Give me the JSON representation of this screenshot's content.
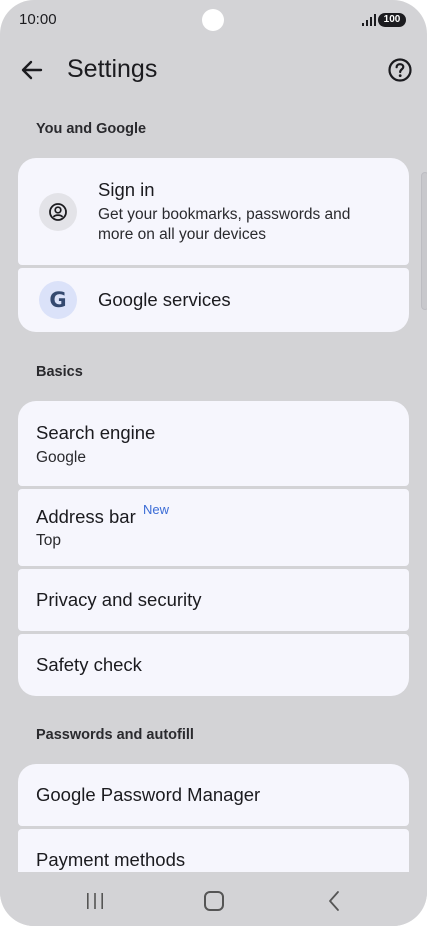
{
  "status": {
    "time": "10:00",
    "battery": "100"
  },
  "app_bar": {
    "title": "Settings"
  },
  "sections": {
    "you_and_google": {
      "header": "You and Google",
      "sign_in": {
        "title": "Sign in",
        "subtitle_line1": "Get your bookmarks, passwords and",
        "subtitle_line2": "more on all your devices"
      },
      "google_services": {
        "title": "Google services",
        "icon_letter": "G"
      }
    },
    "basics": {
      "header": "Basics",
      "search_engine": {
        "title": "Search engine",
        "value": "Google"
      },
      "address_bar": {
        "title": "Address bar",
        "badge": "New",
        "value": "Top"
      },
      "privacy": {
        "title": "Privacy and security"
      },
      "safety_check": {
        "title": "Safety check"
      }
    },
    "passwords": {
      "header": "Passwords and autofill",
      "password_manager": {
        "title": "Google Password Manager"
      },
      "payment_methods": {
        "title": "Payment methods"
      }
    }
  },
  "colors": {
    "background": "#d3d3d6",
    "card": "#f6f6fd",
    "accent": "#3b6cd6"
  },
  "icons": {
    "back": "arrow-left-icon",
    "help": "help-circle-icon",
    "account": "account-circle-icon"
  }
}
